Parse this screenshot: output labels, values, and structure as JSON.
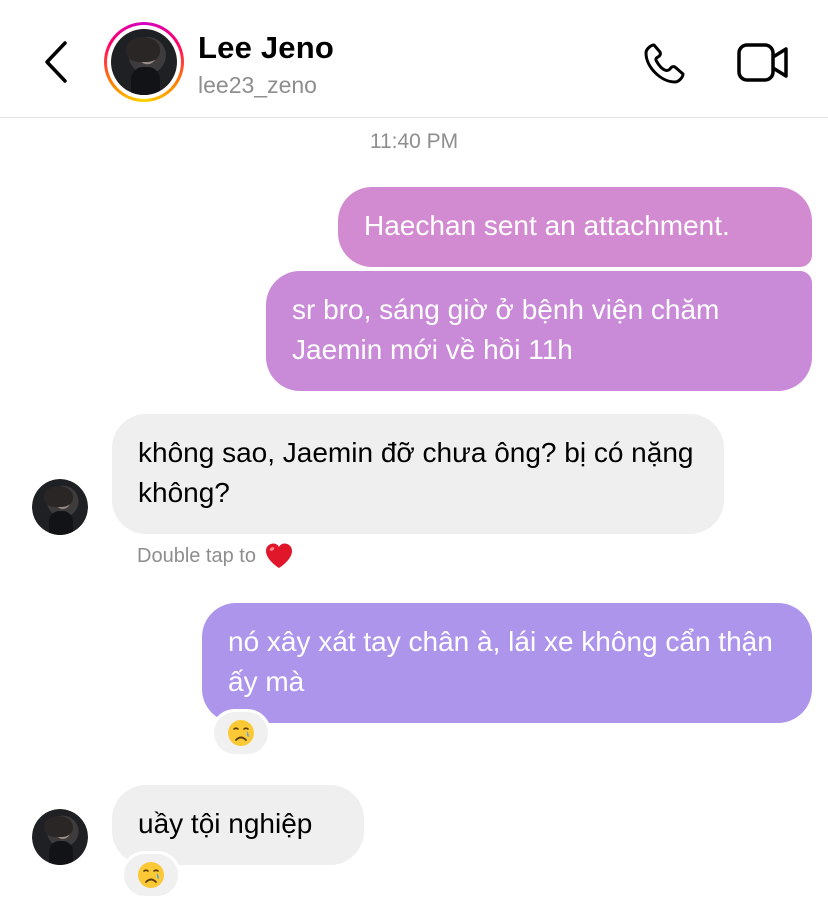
{
  "header": {
    "name": "Lee Jeno",
    "username": "lee23_zeno"
  },
  "timestamp": "11:40 PM",
  "messages": [
    {
      "from": "me",
      "text": "Haechan sent an attachment."
    },
    {
      "from": "me",
      "text": "sr bro, sáng giờ ở bệnh viện chăm Jaemin mới về hồi 11h"
    },
    {
      "from": "them",
      "text": "không sao, Jaemin đỡ chưa ông? bị có nặng không?"
    },
    {
      "from": "me",
      "text": "nó xây xát tay chân à, lái xe không cẩn thận ấy mà",
      "reaction": "crying-face"
    },
    {
      "from": "them",
      "text": "uầy tội nghiệp",
      "reaction": "crying-face"
    }
  ],
  "hint": {
    "text": "Double tap to",
    "icon": "red-heart"
  },
  "colors": {
    "sent_bubble_1": "#d28ad1",
    "sent_bubble_2": "#c98ad8",
    "sent_bubble_3": "#ad95ec",
    "received_bubble": "#efefef",
    "secondary_text": "#8e8e8e"
  },
  "icons": {
    "back": "chevron-left-icon",
    "call": "phone-icon",
    "video": "video-camera-icon"
  }
}
